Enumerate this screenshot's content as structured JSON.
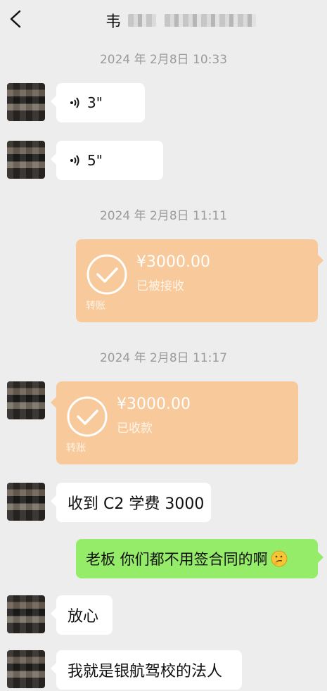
{
  "header": {
    "back_icon": "chevron-left-icon",
    "title_visible": "韦"
  },
  "messages": {
    "ts1": "2024 年 2月8日 10:33",
    "voice1": "3\"",
    "voice2": "5\"",
    "ts2": "2024 年 2月8日 11:11",
    "transfer_sent": {
      "amount": "¥3000.00",
      "status": "已被接收",
      "label": "转账"
    },
    "ts3": "2024 年 2月8日 11:17",
    "transfer_received": {
      "amount": "¥3000.00",
      "status": "已收款",
      "label": "转账"
    },
    "text1": "收到 C2 学费 3000",
    "text_self": "老板 你们都不用签合同的啊",
    "text2": "放心",
    "text3": "我就是银航驾校的法人"
  },
  "colors": {
    "background": "#ededed",
    "bubble_white": "#ffffff",
    "bubble_green": "#95ec69",
    "transfer_orange": "#f8c99a"
  }
}
